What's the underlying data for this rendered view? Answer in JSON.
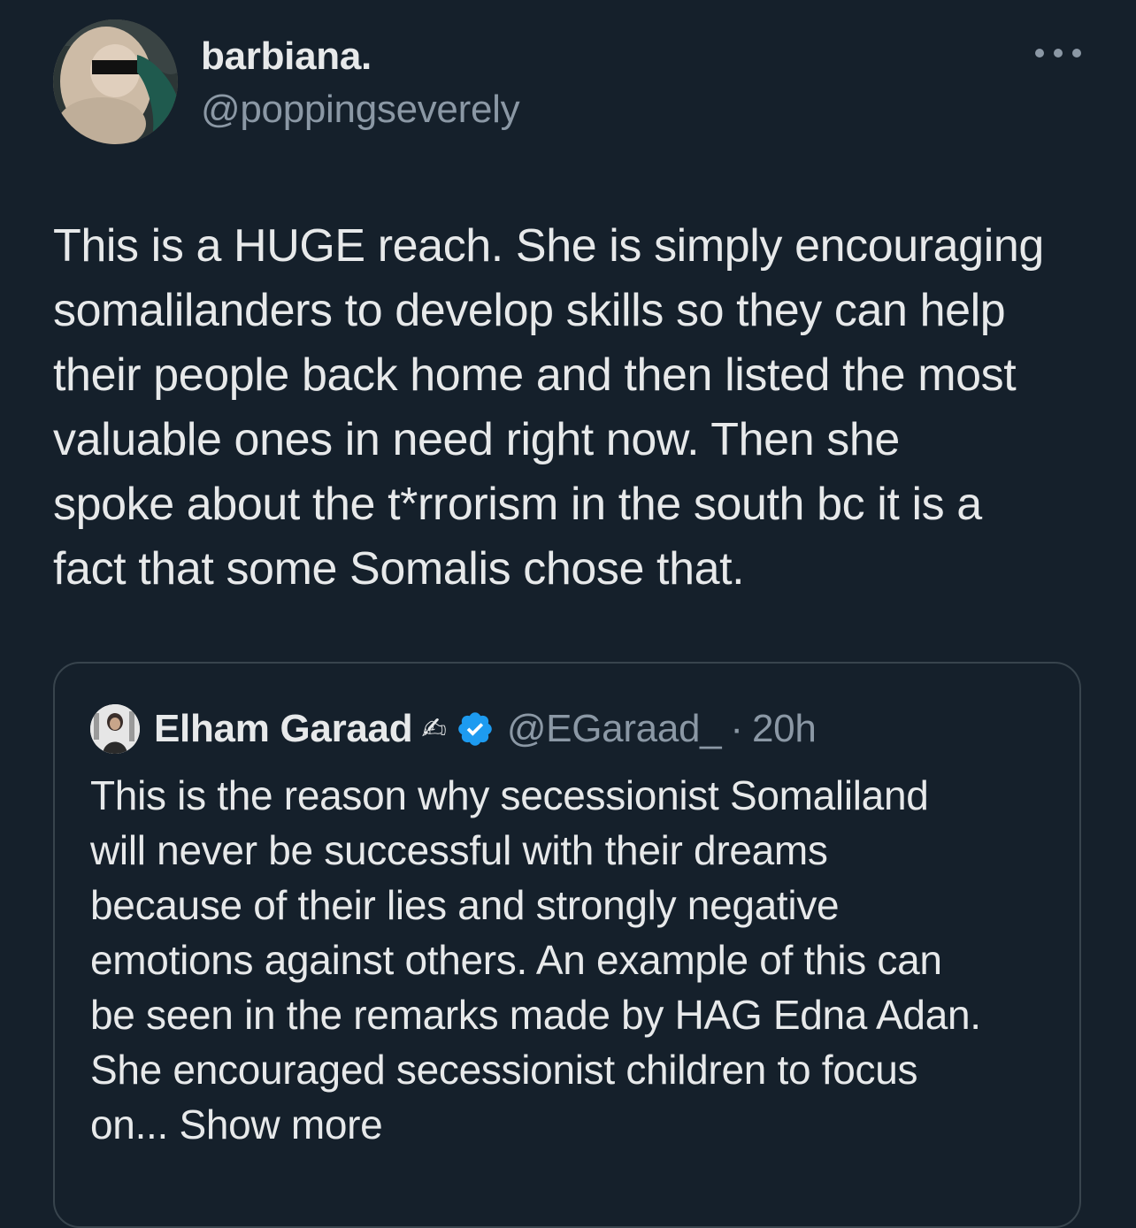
{
  "tweet": {
    "author": {
      "display_name": "barbiana.",
      "handle": "@poppingseverely"
    },
    "text": "This is a HUGE reach. She is simply encouraging\nsomalilanders to develop skills so they can help\ntheir people back home and then listed the most\nvaluable ones in need right now. Then she\nspoke about the t*rrorism in the south bc it is a\nfact that some Somalis chose that.",
    "more_icon": "more-horizontal-icon"
  },
  "quote": {
    "author": {
      "display_name": "Elham Garaad",
      "emoji": "✍",
      "verified_icon": "verified-badge-icon",
      "handle": "@EGaraad_",
      "separator": "·",
      "time": "20h"
    },
    "text": "This is the reason why  secessionist Somaliland\nwill never be successful with their dreams\nbecause of their lies and strongly negative\nemotions against others.  An example of this can\nbe seen in the remarks made by HAG Edna Adan.\nShe encouraged secessionist children to focus\non...",
    "show_more": "Show more"
  },
  "colors": {
    "background": "#15202b",
    "text_primary": "#e7e9ea",
    "text_secondary": "#8b98a5",
    "border": "#38444d",
    "verified": "#1d9bf0"
  }
}
